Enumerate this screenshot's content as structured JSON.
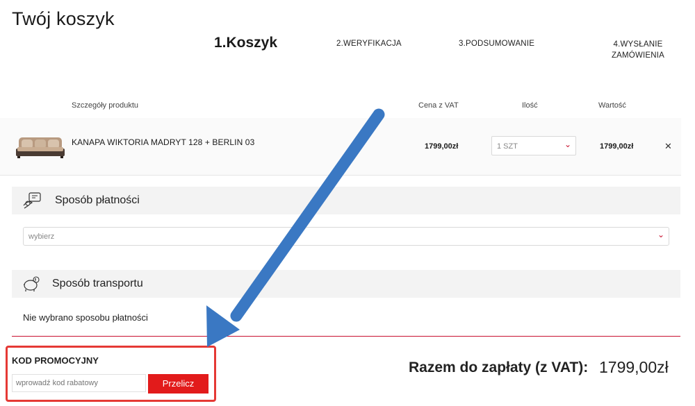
{
  "page": {
    "title": "Twój koszyk"
  },
  "steps": [
    {
      "label": "1.Koszyk"
    },
    {
      "label": "2.WERYFIKACJA"
    },
    {
      "label": "3.PODSUMOWANIE"
    },
    {
      "label": "4.WYSŁANIE ZAMÓWIENIA"
    }
  ],
  "table": {
    "headers": {
      "details": "Szczegóły produktu",
      "price": "Cena z VAT",
      "qty": "Ilość",
      "total": "Wartość"
    },
    "rows": [
      {
        "name": "KANAPA WIKTORIA MADRYT 128 + BERLIN 03",
        "price": "1799,00zł",
        "qty": "1 SZT",
        "total": "1799,00zł"
      }
    ]
  },
  "payment": {
    "title": "Sposób płatności",
    "select_value": "wybierz"
  },
  "transport": {
    "title": "Sposób transportu",
    "message": "Nie wybrano sposobu płatności"
  },
  "promo": {
    "title": "KOD PROMOCYJNY",
    "placeholder": "wprowadź kod rabatowy",
    "button": "Przelicz"
  },
  "summary": {
    "label": "Razem do zapłaty (z VAT):",
    "value": "1799,00zł"
  },
  "icons": {
    "remove": "close-icon",
    "chevron": "chevron-down-icon",
    "payment": "payment-hand-card-icon",
    "transport": "piggy-bank-icon"
  },
  "colors": {
    "accent_red": "#e21b1b",
    "highlight_border": "#e53935",
    "annotation_arrow": "#3a78c3"
  }
}
